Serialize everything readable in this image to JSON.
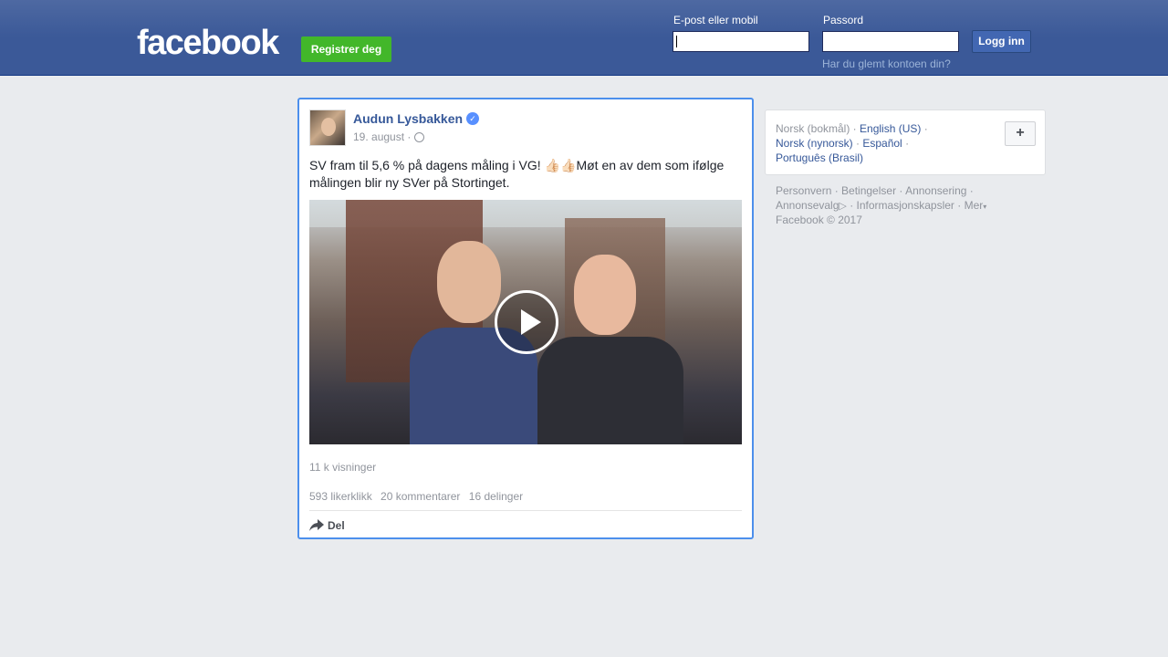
{
  "header": {
    "logo": "facebook",
    "register_label": "Registrer deg",
    "email_label": "E-post eller mobil",
    "password_label": "Passord",
    "login_label": "Logg inn",
    "forgot_link": "Har du glemt kontoen din?"
  },
  "post": {
    "author": "Audun Lysbakken",
    "date": "19. august ·",
    "text_part1": "SV fram til 5,6 % på dagens måling i VG! ",
    "emoji": "👍🏻👍🏻",
    "text_part2": "Møt en av dem som ifølge målingen blir ny SVer på Stortinget.",
    "views": "11 k visninger",
    "likes": "593 likerklikk",
    "comments": "20 kommentarer",
    "shares": "16 delinger",
    "share_label": "Del"
  },
  "languages": {
    "current": "Norsk (bokmål) ·",
    "english": "English (US)",
    "sep1": " ·",
    "nynorsk": "Norsk (nynorsk)",
    "sep2": " · ",
    "espanol": "Español",
    "sep3": " ·",
    "portugues": "Português (Brasil)",
    "plus": "+"
  },
  "footer": {
    "line1": "Personvern · Betingelser · Annonsering ·",
    "line2a": "Annonsevalg",
    "line2b": " · Informasjonskapsler · Mer",
    "line3": "Facebook © 2017"
  },
  "colors": {
    "header_bg": "#3b5998",
    "register_green": "#42b72a",
    "link_blue": "#365899",
    "card_focus_border": "#4c8fec"
  }
}
